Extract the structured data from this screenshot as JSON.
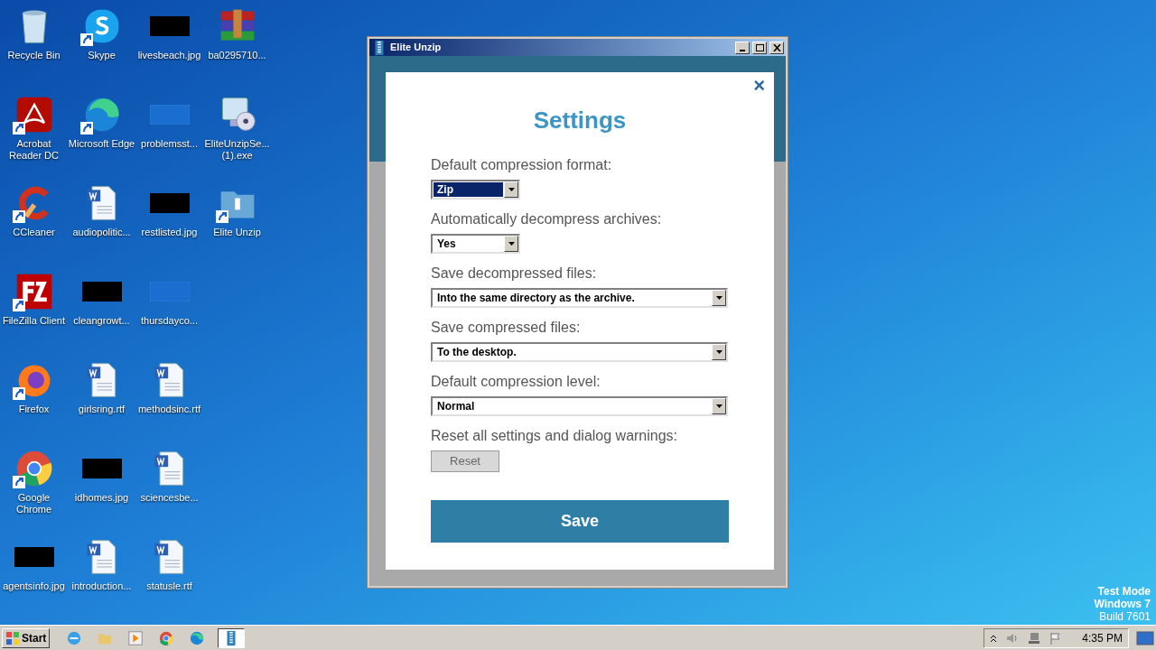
{
  "desktop_icons": [
    {
      "label": "Recycle Bin",
      "kind": "recycle",
      "shortcut": false
    },
    {
      "label": "Acrobat Reader DC",
      "kind": "acrobat",
      "shortcut": true
    },
    {
      "label": "CCleaner",
      "kind": "ccleaner",
      "shortcut": true
    },
    {
      "label": "FileZilla Client",
      "kind": "filezilla",
      "shortcut": true
    },
    {
      "label": "Firefox",
      "kind": "firefox",
      "shortcut": true
    },
    {
      "label": "Google Chrome",
      "kind": "chrome",
      "shortcut": true
    },
    {
      "label": "agentsinfo.jpg",
      "kind": "image",
      "shortcut": false
    },
    {
      "label": "Skype",
      "kind": "skype",
      "shortcut": true
    },
    {
      "label": "Microsoft Edge",
      "kind": "edge",
      "shortcut": true
    },
    {
      "label": "audiopolitic...",
      "kind": "word",
      "shortcut": false
    },
    {
      "label": "cleangrowt...",
      "kind": "image",
      "shortcut": false
    },
    {
      "label": "girlsring.rtf",
      "kind": "word",
      "shortcut": false
    },
    {
      "label": "idhomes.jpg",
      "kind": "image",
      "shortcut": false
    },
    {
      "label": "introduction...",
      "kind": "word",
      "shortcut": false
    },
    {
      "label": "livesbeach.jpg",
      "kind": "image",
      "shortcut": false
    },
    {
      "label": "problemsst...",
      "kind": "blank",
      "shortcut": false
    },
    {
      "label": "restlisted.jpg",
      "kind": "image",
      "shortcut": false
    },
    {
      "label": "thursdayco...",
      "kind": "blank",
      "shortcut": false
    },
    {
      "label": "methodsinc.rtf",
      "kind": "word",
      "shortcut": false
    },
    {
      "label": "sciencesbe...",
      "kind": "word",
      "shortcut": false
    },
    {
      "label": "statusle.rtf",
      "kind": "word",
      "shortcut": false
    },
    {
      "label": "ba0295710...",
      "kind": "winrar",
      "shortcut": false
    },
    {
      "label": "EliteUnzipSe... (1).exe",
      "kind": "setup",
      "shortcut": false
    },
    {
      "label": "Elite Unzip",
      "kind": "unzip",
      "shortcut": true
    }
  ],
  "window": {
    "title": "Elite Unzip",
    "dialog": {
      "title": "Settings",
      "close": "×",
      "fields": [
        {
          "label": "Default compression format:",
          "value": "Zip",
          "kind": "narrow",
          "focused": true
        },
        {
          "label": "Automatically decompress archives:",
          "value": "Yes",
          "kind": "narrow",
          "focused": false
        },
        {
          "label": "Save decompressed files:",
          "value": "Into the same directory as the archive.",
          "kind": "wide",
          "focused": false
        },
        {
          "label": "Save compressed files:",
          "value": "To the desktop.",
          "kind": "wide",
          "focused": false
        },
        {
          "label": "Default compression level:",
          "value": "Normal",
          "kind": "wide",
          "focused": false
        }
      ],
      "reset_label": "Reset all settings and dialog warnings:",
      "reset_button": "Reset",
      "save_button": "Save"
    }
  },
  "watermark_os": [
    "Test Mode",
    "Windows 7",
    "Build 7601"
  ],
  "taskbar": {
    "start": "Start",
    "apps": [
      {
        "kind": "ie",
        "active": false
      },
      {
        "kind": "explorer",
        "active": false
      },
      {
        "kind": "media",
        "active": false
      },
      {
        "kind": "chrome",
        "active": false
      },
      {
        "kind": "edge",
        "active": false
      },
      {
        "kind": "unzip",
        "active": true
      }
    ],
    "time": "4:35 PM"
  }
}
